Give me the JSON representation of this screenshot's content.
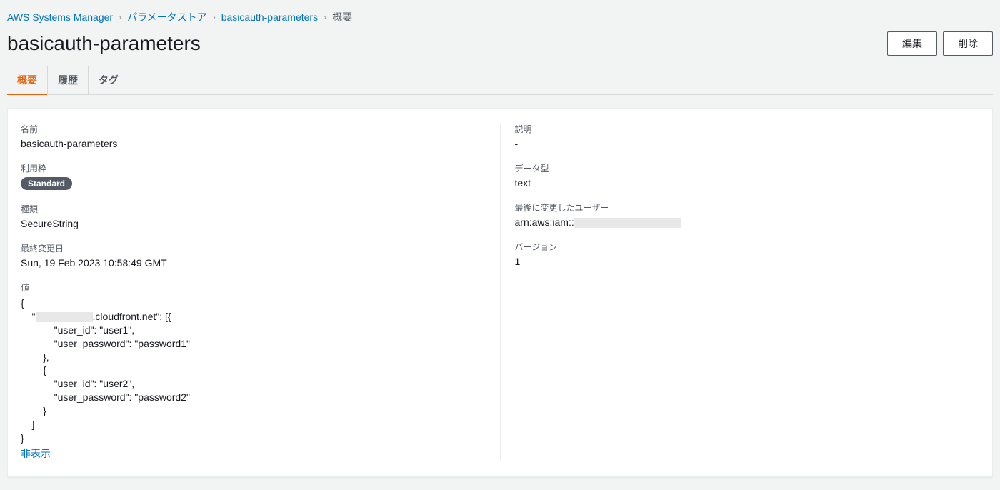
{
  "breadcrumbs": {
    "root": "AWS Systems Manager",
    "store": "パラメータストア",
    "param": "basicauth-parameters",
    "current": "概要"
  },
  "header": {
    "title": "basicauth-parameters",
    "edit": "編集",
    "delete": "削除"
  },
  "tabs": {
    "overview": "概要",
    "history": "履歴",
    "tags": "タグ"
  },
  "left": {
    "name_label": "名前",
    "name_value": "basicauth-parameters",
    "tier_label": "利用枠",
    "tier_value": "Standard",
    "type_label": "種類",
    "type_value": "SecureString",
    "modified_label": "最終変更日",
    "modified_value": "Sun, 19 Feb 2023 10:58:49 GMT",
    "value_label": "値",
    "value_prefix": "{\n    \"",
    "value_suffix": ".cloudfront.net\": [{\n            \"user_id\": \"user1\",\n            \"user_password\": \"password1\"\n        },\n        {\n            \"user_id\": \"user2\",\n            \"user_password\": \"password2\"\n        }\n    ]\n}",
    "hide_link": "非表示"
  },
  "right": {
    "desc_label": "説明",
    "desc_value": "-",
    "datatype_label": "データ型",
    "datatype_value": "text",
    "lastuser_label": "最後に変更したユーザー",
    "lastuser_prefix": "arn:aws:iam::",
    "version_label": "バージョン",
    "version_value": "1"
  }
}
